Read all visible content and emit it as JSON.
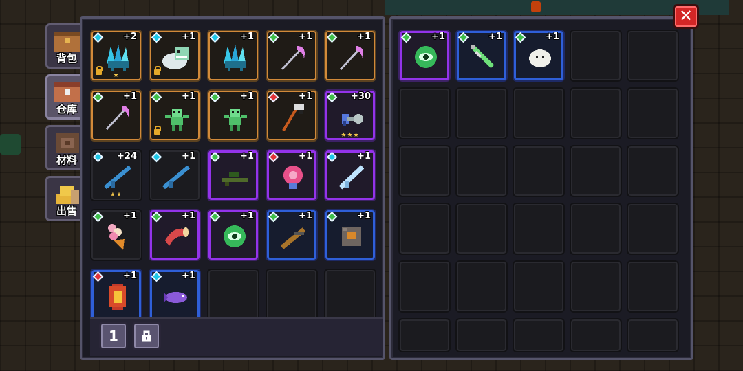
{
  "tabs": [
    {
      "label": "背包",
      "icon": "backpack-chest-icon",
      "active": false
    },
    {
      "label": "仓库",
      "icon": "warehouse-chest-icon",
      "active": true
    },
    {
      "label": "材料",
      "icon": "materials-box-icon",
      "active": false
    },
    {
      "label": "出售",
      "icon": "sell-gold-icon",
      "active": false
    }
  ],
  "left_grid": [
    [
      {
        "rarity": "orange",
        "gem": "cyan",
        "count": "+2",
        "locked": true,
        "stars": "★",
        "icon": "crystal-crab-icon"
      },
      {
        "rarity": "orange",
        "gem": "cyan",
        "count": "+1",
        "locked": true,
        "stars": "",
        "icon": "ghost-fish-pet-icon"
      },
      {
        "rarity": "orange",
        "gem": "cyan",
        "count": "+1",
        "locked": false,
        "stars": "",
        "icon": "crystal-crab-icon"
      },
      {
        "rarity": "orange",
        "gem": "green",
        "count": "+1",
        "locked": false,
        "stars": "",
        "icon": "scythe-icon"
      },
      {
        "rarity": "orange",
        "gem": "green",
        "count": "+1",
        "locked": false,
        "stars": "",
        "icon": "scythe-icon"
      }
    ],
    [
      {
        "rarity": "orange",
        "gem": "green",
        "count": "+1",
        "locked": false,
        "stars": "",
        "icon": "scythe-icon"
      },
      {
        "rarity": "orange",
        "gem": "green",
        "count": "+1",
        "locked": true,
        "stars": "",
        "icon": "green-goblin-icon"
      },
      {
        "rarity": "orange",
        "gem": "green",
        "count": "+1",
        "locked": false,
        "stars": "",
        "icon": "green-goblin-icon"
      },
      {
        "rarity": "orange",
        "gem": "red",
        "count": "+1",
        "locked": false,
        "stars": "",
        "icon": "bone-staff-icon"
      },
      {
        "rarity": "purple",
        "gem": "green",
        "count": "+30",
        "locked": false,
        "stars": "★★★",
        "icon": "plasma-gun-icon"
      }
    ],
    [
      {
        "rarity": "",
        "gem": "cyan",
        "count": "+24",
        "locked": false,
        "stars": "★★",
        "icon": "assault-rifle-icon"
      },
      {
        "rarity": "",
        "gem": "cyan",
        "count": "+1",
        "locked": false,
        "stars": "",
        "icon": "assault-rifle-icon"
      },
      {
        "rarity": "purple",
        "gem": "green",
        "count": "+1",
        "locked": false,
        "stars": "",
        "icon": "sniper-rifle-icon"
      },
      {
        "rarity": "purple",
        "gem": "red",
        "count": "+1",
        "locked": false,
        "stars": "",
        "icon": "pink-flower-icon"
      },
      {
        "rarity": "purple",
        "gem": "cyan",
        "count": "+1",
        "locked": false,
        "stars": "",
        "icon": "ice-blaster-icon"
      }
    ],
    [
      {
        "rarity": "",
        "gem": "green",
        "count": "+1",
        "locked": false,
        "stars": "",
        "icon": "ice-cream-icon"
      },
      {
        "rarity": "purple",
        "gem": "green",
        "count": "+1",
        "locked": false,
        "stars": "",
        "icon": "horn-icon"
      },
      {
        "rarity": "purple",
        "gem": "green",
        "count": "+1",
        "locked": false,
        "stars": "",
        "icon": "green-eye-icon"
      },
      {
        "rarity": "blue",
        "gem": "green",
        "count": "+1",
        "locked": false,
        "stars": "",
        "icon": "shotgun-icon"
      },
      {
        "rarity": "blue",
        "gem": "green",
        "count": "+1",
        "locked": false,
        "stars": "",
        "icon": "stone-block-icon"
      }
    ],
    [
      {
        "rarity": "blue",
        "gem": "red",
        "count": "+1",
        "locked": false,
        "stars": "",
        "icon": "lantern-icon"
      },
      {
        "rarity": "blue",
        "gem": "cyan",
        "count": "+1",
        "locked": false,
        "stars": "",
        "icon": "purple-fish-icon"
      },
      null,
      null,
      null
    ]
  ],
  "right_grid_items": [
    {
      "rarity": "purple",
      "gem": "green",
      "count": "+1",
      "icon": "green-eye-icon"
    },
    {
      "rarity": "blue",
      "gem": "green",
      "count": "+1",
      "icon": "green-sword-icon"
    },
    {
      "rarity": "blue",
      "gem": "green",
      "count": "+1",
      "icon": "white-slime-icon"
    }
  ],
  "bottom_buttons": [
    {
      "label": "1",
      "name": "page-1-button"
    },
    {
      "label": "",
      "name": "lock-toggle-button",
      "icon": "padlock-icon"
    }
  ],
  "close_label": "✕"
}
